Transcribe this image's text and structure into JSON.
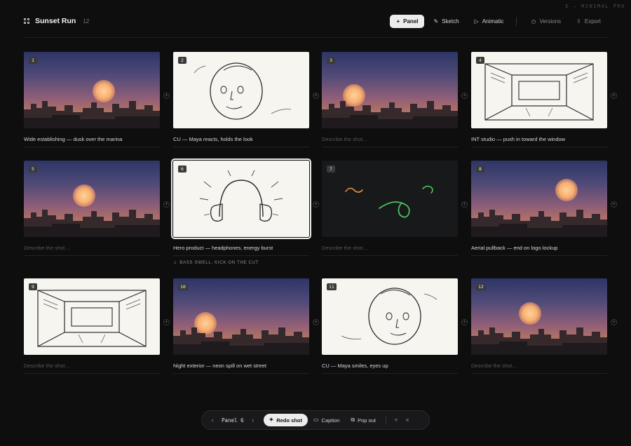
{
  "corner_tag": "E — MINIMAL PRO",
  "header": {
    "title": "Sunset Run",
    "count": "12",
    "actions": {
      "panel": "Panel",
      "sketch": "Sketch",
      "animatic": "Animatic",
      "versions": "Versions",
      "export": "Export"
    }
  },
  "panels": [
    {
      "num": "1",
      "kind": "sky",
      "caption": "Wide establishing — dusk over the marina"
    },
    {
      "num": "2",
      "kind": "face",
      "caption": "CU — Maya reacts, holds the look"
    },
    {
      "num": "3",
      "kind": "sky",
      "caption": "",
      "placeholder": "Describe the shot…"
    },
    {
      "num": "4",
      "kind": "room",
      "caption": "INT studio — push in toward the window"
    },
    {
      "num": "5",
      "kind": "sky",
      "caption": "",
      "placeholder": "Describe the shot…"
    },
    {
      "num": "6",
      "kind": "headphones",
      "caption": "Hero product — headphones, energy burst",
      "note": "BASS SWELL, KICK ON THE CUT",
      "selected": true
    },
    {
      "num": "7",
      "kind": "dark",
      "caption": "",
      "placeholder": "Describe the shot…"
    },
    {
      "num": "8",
      "kind": "sky",
      "caption": "Aerial pullback — end on logo lockup"
    },
    {
      "num": "9",
      "kind": "room",
      "caption": "",
      "placeholder": "Describe the shot…"
    },
    {
      "num": "10",
      "kind": "sky",
      "caption": "Night exterior — neon spill on wet street"
    },
    {
      "num": "11",
      "kind": "face",
      "caption": "CU — Maya smiles, eyes up"
    },
    {
      "num": "12",
      "kind": "sky",
      "caption": "",
      "placeholder": "Describe the shot…"
    }
  ],
  "bottom_bar": {
    "panel_label": "Panel 6",
    "redo": "Redo shot",
    "caption": "Caption",
    "popout": "Pop out"
  },
  "colors": {
    "background": "#0e0e0f",
    "primary_button": "#ececec",
    "neon_orange": "#e8923a",
    "neon_green": "#4cc25e"
  }
}
